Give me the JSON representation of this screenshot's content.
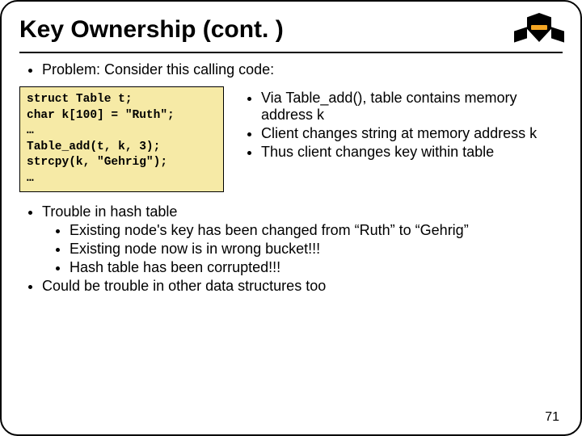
{
  "title": "Key Ownership (cont. )",
  "intro": "Problem: Consider this calling code:",
  "code": "struct Table t;\nchar k[100] = \"Ruth\";\n…\nTable_add(t, k, 3);\nstrcpy(k, \"Gehrig\");\n…",
  "right": {
    "b1": "Via Table_add(), table contains memory address k",
    "b2": "Client changes string at memory address k",
    "b3": "Thus client changes key within table"
  },
  "lower": {
    "t1": "Trouble in hash table",
    "s1": "Existing node's key has been changed from “Ruth” to “Gehrig”",
    "s2": "Existing node now is in wrong bucket!!!",
    "s3": "Hash table has been corrupted!!!",
    "t2": "Could be trouble in other data structures too"
  },
  "page": "71"
}
